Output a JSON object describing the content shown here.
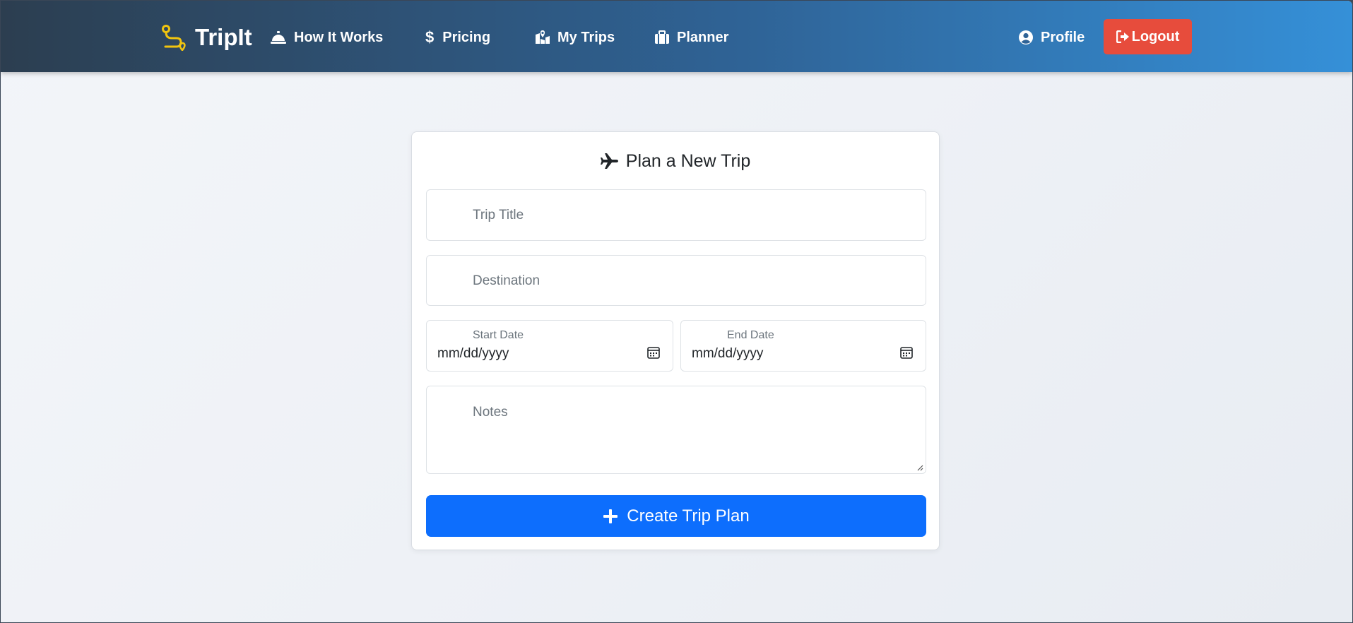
{
  "navbar": {
    "brand": "TripIt",
    "links": [
      {
        "label": "How It Works",
        "icon": "concierge-bell-icon"
      },
      {
        "label": "Pricing",
        "icon": "dollar-icon"
      },
      {
        "label": "My Trips",
        "icon": "map-location-icon"
      },
      {
        "label": "Planner",
        "icon": "suitcase-icon"
      }
    ],
    "profile": "Profile",
    "logout": "Logout"
  },
  "form": {
    "title": "Plan a New Trip",
    "trip_title_placeholder": "Trip Title",
    "destination_placeholder": "Destination",
    "start_date_label": "Start Date",
    "start_date_value": "mm/dd/yyyy",
    "end_date_label": "End Date",
    "end_date_value": "mm/dd/yyyy",
    "notes_placeholder": "Notes",
    "submit_label": "Create Trip Plan"
  },
  "colors": {
    "brand_accent": "#f1c40f",
    "logout": "#e74c3c",
    "primary": "#0d6efd"
  }
}
